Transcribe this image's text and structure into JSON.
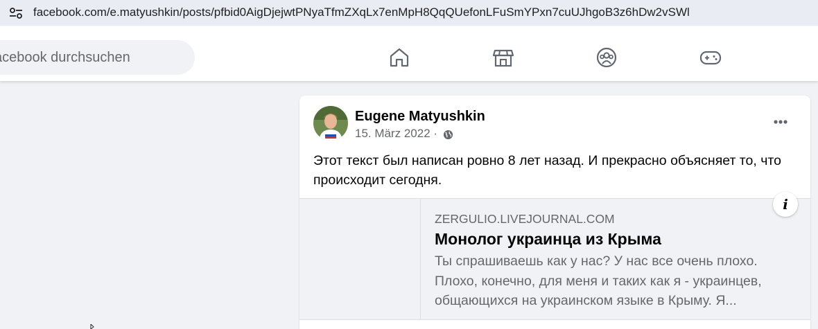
{
  "browser": {
    "url": "facebook.com/e.matyushkin/posts/pfbid0AigDjejwtPNyaTfmZXqLx7enMpH8QqQUefonLFuSmYPxn7cuUJhgoB3z6hDw2vSWl",
    "site_info_icon": "tune-icon"
  },
  "nav": {
    "search_placeholder": "acebook durchsuchen",
    "icons": [
      "home-icon",
      "marketplace-icon",
      "groups-icon",
      "gaming-icon"
    ]
  },
  "post": {
    "author": "Eugene Matyushkin",
    "date": "15. März 2022 ·",
    "privacy_icon": "globe-icon",
    "text": "Этот текст был написан ровно 8 лет назад. И прекрасно объясняет то, что происходит сегодня.",
    "link": {
      "domain": "ZERGULIO.LIVEJOURNAL.COM",
      "title": "Монолог украинца из Крыма",
      "description": "Ты спрашиваешь как у нас? У нас все очень плохо. Плохо, конечно, для меня и таких как я - украинцев, общающихся на украинском языке в Крыму. Я..."
    },
    "info_glyph": "i"
  },
  "colors": {
    "nav_bg": "#ffffff",
    "page_bg": "#f0f2f5",
    "text_primary": "#050505",
    "text_secondary": "#65676b",
    "nav_icon": "#606770"
  }
}
